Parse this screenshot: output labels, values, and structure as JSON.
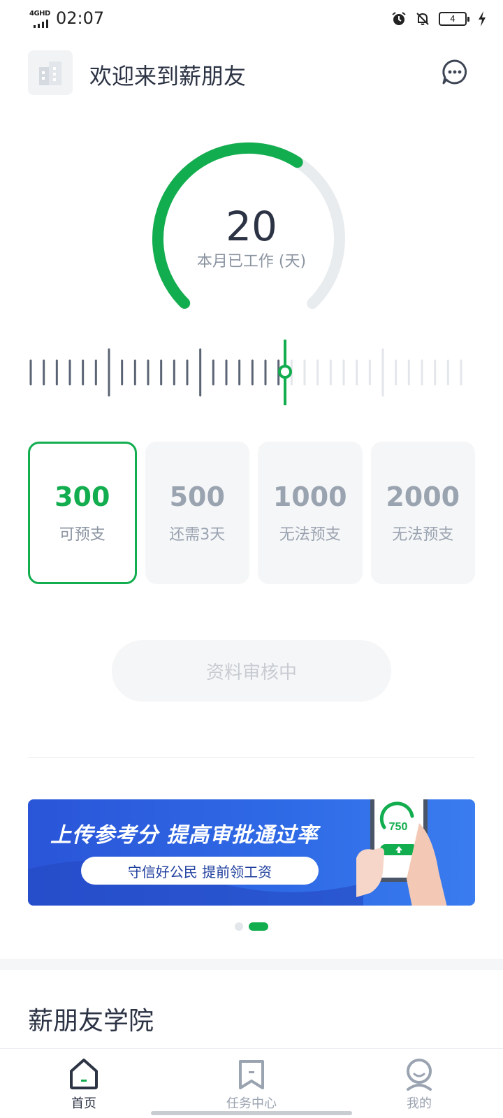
{
  "status_bar": {
    "network": "4GHD",
    "time": "02:07",
    "battery": "4",
    "icons": [
      "alarm-icon",
      "bell-off-icon",
      "battery-icon",
      "charging-icon"
    ]
  },
  "header": {
    "title": "欢迎来到薪朋友",
    "logo_icon": "building-icon",
    "message_icon": "chat-icon"
  },
  "gauge": {
    "value": "20",
    "label": "本月已工作 (天)",
    "progress_fraction": 0.62
  },
  "ruler": {
    "active_ticks": 20,
    "total_ticks": 34,
    "colors": {
      "active": "#5b6474",
      "inactive": "#e3e6ea",
      "accent": "#12ad4e"
    }
  },
  "options": [
    {
      "amount": "300",
      "status": "可预支",
      "selected": true
    },
    {
      "amount": "500",
      "status": "还需3天",
      "selected": false
    },
    {
      "amount": "1000",
      "status": "无法预支",
      "selected": false
    },
    {
      "amount": "2000",
      "status": "无法预支",
      "selected": false
    }
  ],
  "submit": {
    "label": "资料审核中",
    "disabled": true
  },
  "banner": {
    "title": "上传参考分 提高审批通过率",
    "subtitle": "守信好公民  提前领工资",
    "score": "750"
  },
  "carousel": {
    "count": 2,
    "active_index": 1
  },
  "section": {
    "title": "薪朋友学院"
  },
  "bottom_nav": [
    {
      "label": "首页",
      "icon": "home-icon",
      "active": true
    },
    {
      "label": "任务中心",
      "icon": "bookmark-icon",
      "active": false
    },
    {
      "label": "我的",
      "icon": "profile-icon",
      "active": false
    }
  ],
  "colors": {
    "accent": "#12ad4e",
    "text_primary": "#2c3344",
    "text_secondary": "#8a93a0",
    "banner_blue": "#2f6be6"
  }
}
